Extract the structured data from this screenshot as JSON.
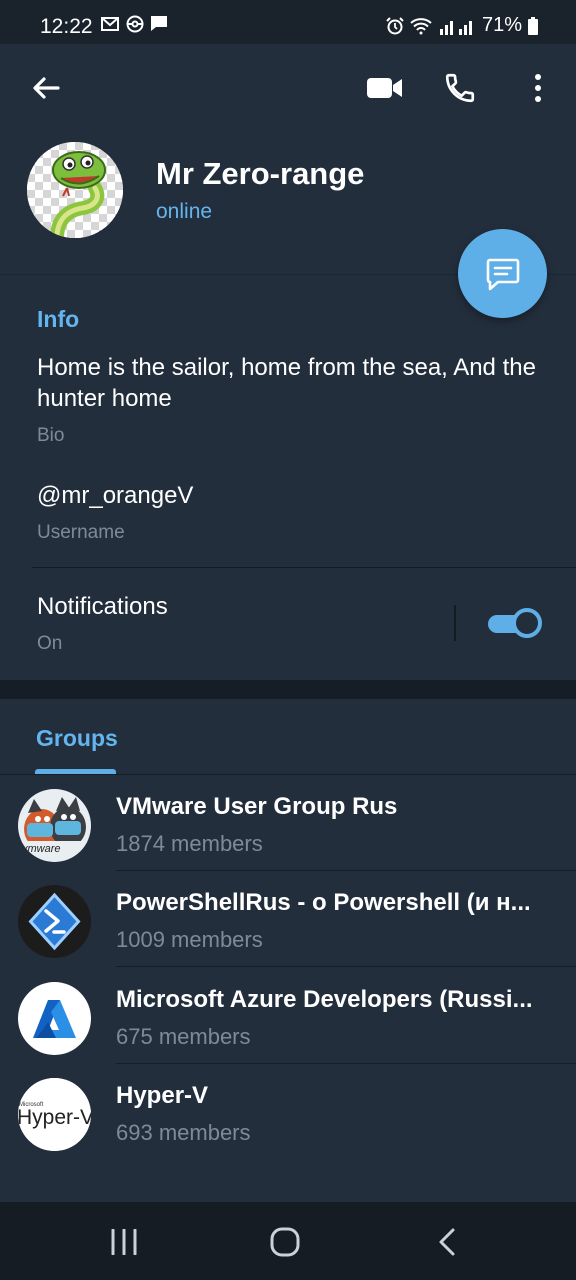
{
  "status_bar": {
    "time": "12:22",
    "battery": "71%"
  },
  "profile": {
    "name": "Mr Zero-range",
    "status": "online"
  },
  "info": {
    "title": "Info",
    "bio": "Home is the sailor, home from the sea, And the hunter home",
    "bio_caption": "Bio",
    "username": "@mr_orangeV",
    "username_caption": "Username",
    "notifications_label": "Notifications",
    "notifications_value": "On",
    "notifications_enabled": true
  },
  "groups": {
    "tab_label": "Groups",
    "items": [
      {
        "name": "VMware User Group Rus",
        "members": "1874 members",
        "icon": "vmware-cats-avatar"
      },
      {
        "name": "PowerShellRus - о Powershell (и н...",
        "members": "1009 members",
        "icon": "powershell-avatar"
      },
      {
        "name": "Microsoft Azure Developers (Russi...",
        "members": "675 members",
        "icon": "azure-avatar"
      },
      {
        "name": "Hyper-V",
        "members": "693 members",
        "icon": "hyperv-avatar"
      }
    ],
    "hyperv_logo_small": "Microsoft",
    "hyperv_logo_big": "Hyper-V"
  },
  "colors": {
    "accent": "#5eaee8",
    "link": "#64b5ef",
    "background": "#232e3c",
    "muted_text": "#7d8b99"
  }
}
